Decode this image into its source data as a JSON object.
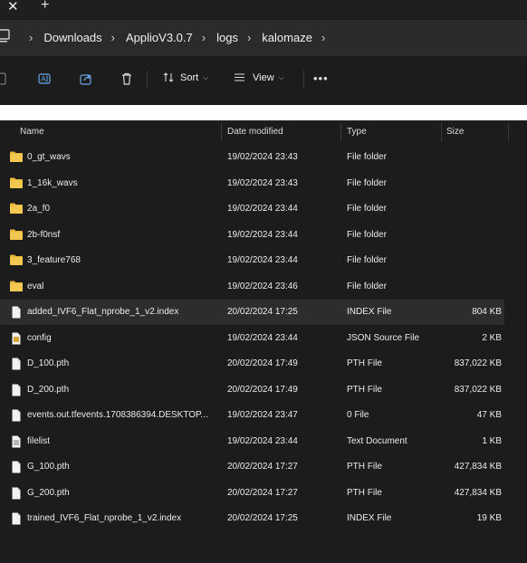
{
  "window": {
    "close_glyph": "✕",
    "new_tab_glyph": "+"
  },
  "breadcrumb": [
    "Downloads",
    "ApplioV3.0.7",
    "logs",
    "kalomaze"
  ],
  "toolbar": {
    "sort_label": "Sort",
    "view_label": "View",
    "more_label": "•••"
  },
  "columns": {
    "name": "Name",
    "date": "Date modified",
    "type": "Type",
    "size": "Size"
  },
  "files": [
    {
      "name": "0_gt_wavs",
      "date": "19/02/2024 23:43",
      "type": "File folder",
      "size": "",
      "icon": "folder-icon"
    },
    {
      "name": "1_16k_wavs",
      "date": "19/02/2024 23:43",
      "type": "File folder",
      "size": "",
      "icon": "folder-icon"
    },
    {
      "name": "2a_f0",
      "date": "19/02/2024 23:44",
      "type": "File folder",
      "size": "",
      "icon": "folder-icon"
    },
    {
      "name": "2b-f0nsf",
      "date": "19/02/2024 23:44",
      "type": "File folder",
      "size": "",
      "icon": "folder-icon"
    },
    {
      "name": "3_feature768",
      "date": "19/02/2024 23:44",
      "type": "File folder",
      "size": "",
      "icon": "folder-icon"
    },
    {
      "name": "eval",
      "date": "19/02/2024 23:46",
      "type": "File folder",
      "size": "",
      "icon": "folder-icon"
    },
    {
      "name": "added_IVF6_Flat_nprobe_1_v2.index",
      "date": "20/02/2024 17:25",
      "type": "INDEX File",
      "size": "804 KB",
      "icon": "file-icon",
      "selected": true
    },
    {
      "name": "config",
      "date": "19/02/2024 23:44",
      "type": "JSON Source File",
      "size": "2 KB",
      "icon": "json-file-icon"
    },
    {
      "name": "D_100.pth",
      "date": "20/02/2024 17:49",
      "type": "PTH File",
      "size": "837,022 KB",
      "icon": "file-icon"
    },
    {
      "name": "D_200.pth",
      "date": "20/02/2024 17:49",
      "type": "PTH File",
      "size": "837,022 KB",
      "icon": "file-icon"
    },
    {
      "name": "events.out.tfevents.1708386394.DESKTOP...",
      "date": "19/02/2024 23:47",
      "type": "0 File",
      "size": "47 KB",
      "icon": "file-icon"
    },
    {
      "name": "filelist",
      "date": "19/02/2024 23:44",
      "type": "Text Document",
      "size": "1 KB",
      "icon": "text-file-icon"
    },
    {
      "name": "G_100.pth",
      "date": "20/02/2024 17:27",
      "type": "PTH File",
      "size": "427,834 KB",
      "icon": "file-icon"
    },
    {
      "name": "G_200.pth",
      "date": "20/02/2024 17:27",
      "type": "PTH File",
      "size": "427,834 KB",
      "icon": "file-icon"
    },
    {
      "name": "trained_IVF6_Flat_nprobe_1_v2.index",
      "date": "20/02/2024 17:25",
      "type": "INDEX File",
      "size": "19 KB",
      "icon": "file-icon"
    }
  ],
  "colors": {
    "background": "#1c1c1c",
    "addressbar": "#2b2b2b",
    "folder": "#e8b73c",
    "selected_row": "#2d2d2d"
  }
}
